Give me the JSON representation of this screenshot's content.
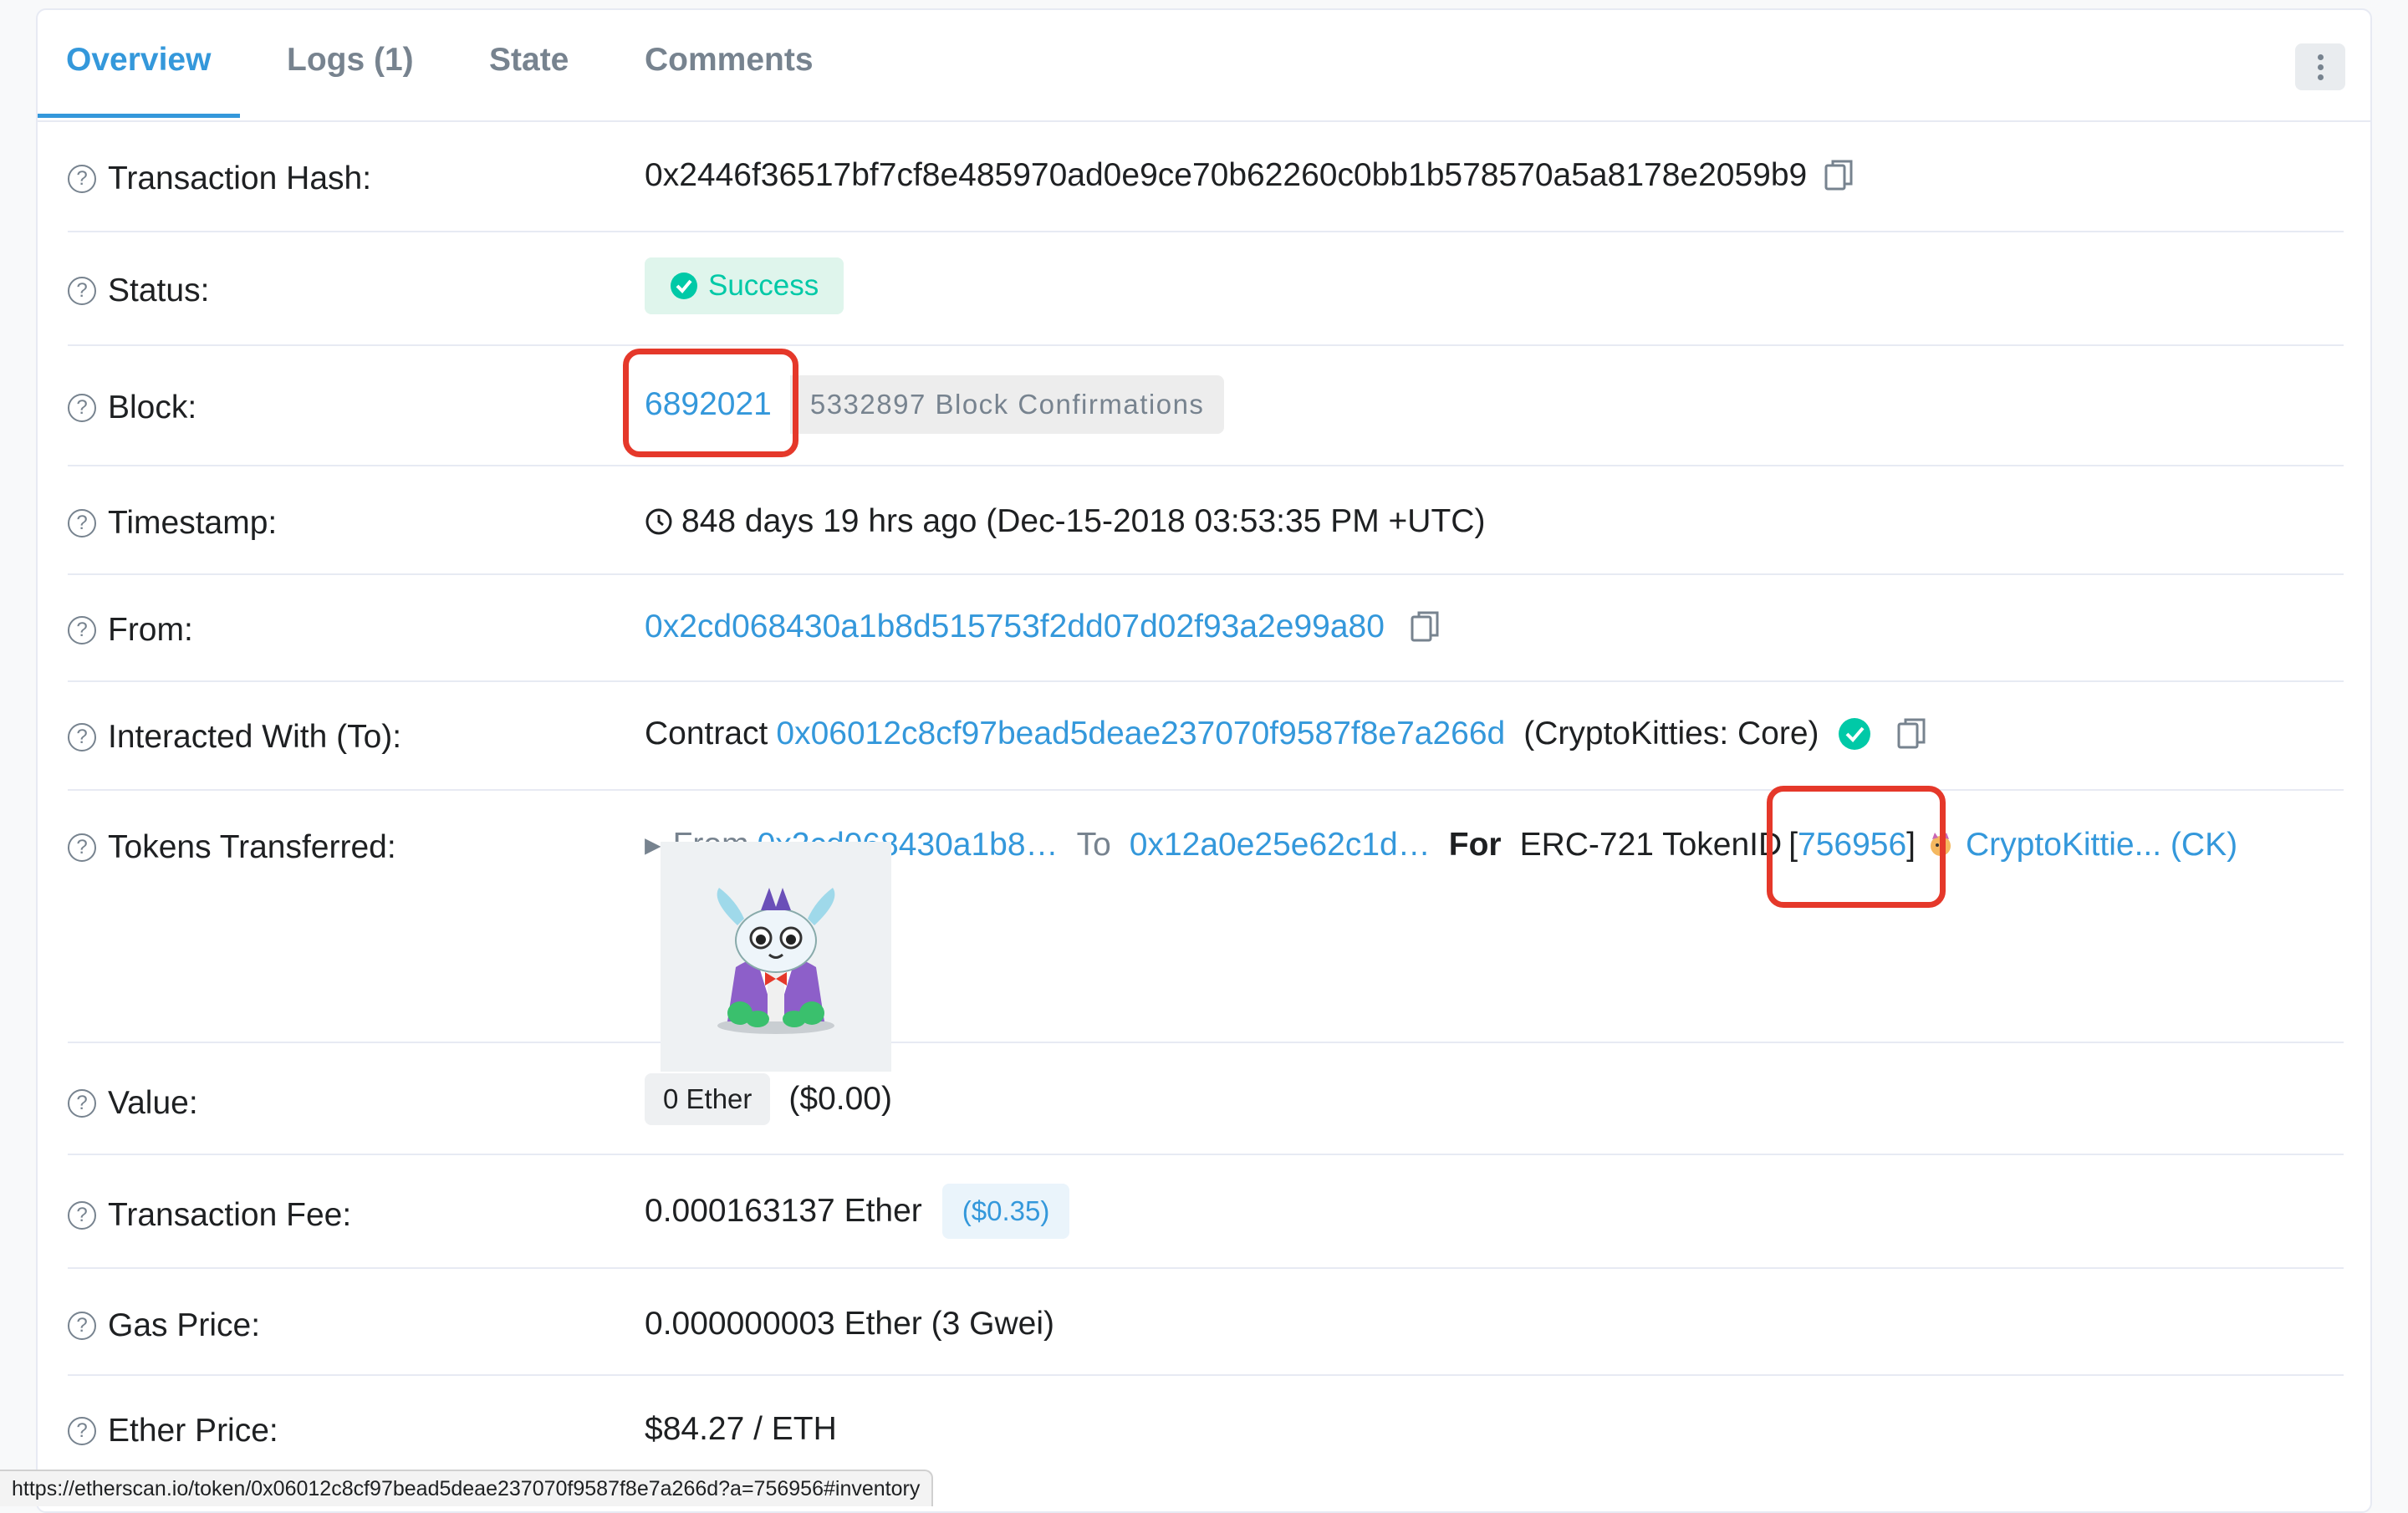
{
  "tabs": [
    {
      "label": "Overview",
      "active": true
    },
    {
      "label": "Logs (1)"
    },
    {
      "label": "State"
    },
    {
      "label": "Comments"
    }
  ],
  "rows": {
    "tx_hash": {
      "label": "Transaction Hash:",
      "value": "0x2446f36517bf7cf8e485970ad0e9ce70b62260c0bb1b578570a5a8178e2059b9"
    },
    "status": {
      "label": "Status:",
      "value": "Success"
    },
    "block": {
      "label": "Block:",
      "value": "6892021",
      "confirmations": "5332897 Block Confirmations"
    },
    "timestamp": {
      "label": "Timestamp:",
      "value": "848 days 19 hrs ago (Dec-15-2018 03:53:35 PM +UTC)"
    },
    "from": {
      "label": "From:",
      "value": "0x2cd068430a1b8d515753f2dd07d02f93a2e99a80"
    },
    "to": {
      "label": "Interacted With (To):",
      "prefix": "Contract",
      "address": "0x06012c8cf97bead5deae237070f9587f8e7a266d",
      "name": "(CryptoKitties: Core)"
    },
    "tokens": {
      "label": "Tokens Transferred:",
      "from_label": "From",
      "from_addr": "0x2cd068430a1b8…",
      "to_label": "To",
      "to_addr": "0x12a0e25e62c1d…",
      "for_label": "For",
      "token_type": "ERC-721 TokenID",
      "bracket_open": "[",
      "token_id": "756956",
      "bracket_close": "]",
      "token_name": "CryptoKittie... (CK)"
    },
    "value": {
      "label": "Value:",
      "amount": "0 Ether",
      "usd": "($0.00)"
    },
    "fee": {
      "label": "Transaction Fee:",
      "amount": "0.000163137 Ether",
      "usd": "($0.35)"
    },
    "gas": {
      "label": "Gas Price:",
      "value": "0.000000003 Ether (3 Gwei)"
    },
    "ether_price": {
      "label": "Ether Price:",
      "value": "$84.27 / ETH"
    }
  },
  "status_bar": {
    "url": "https://etherscan.io/token/0x06012c8cf97bead5deae237070f9587f8e7a266d?a=756956#inventory"
  },
  "colors": {
    "link": "#3498db",
    "success": "#00c9a7",
    "highlight": "#e5382a"
  }
}
